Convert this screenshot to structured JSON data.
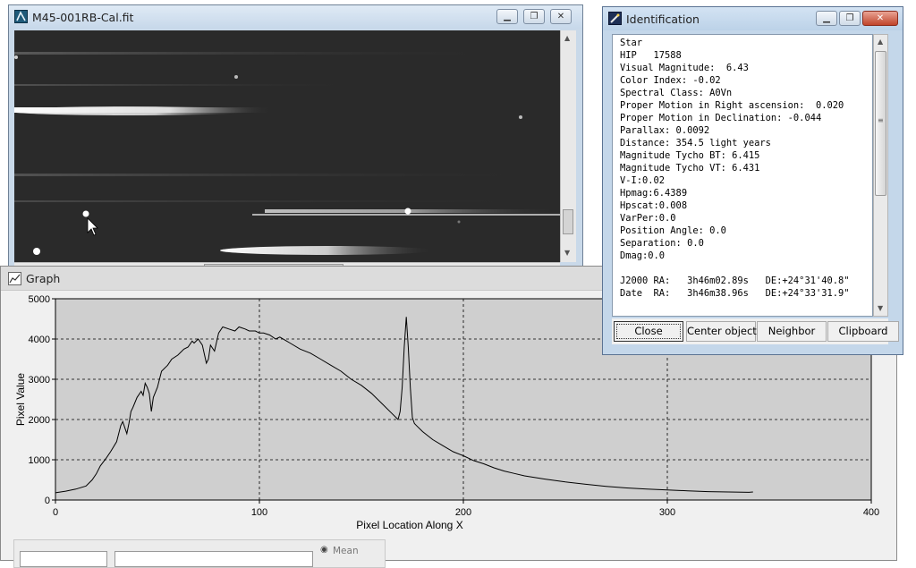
{
  "image_window": {
    "title": "M45-001RB-Cal.fit",
    "icon": "fits-image-icon"
  },
  "graph_window": {
    "title": "Graph",
    "icon": "graph-window-icon",
    "bottom_controls": {
      "mean_label": "Mean"
    }
  },
  "identification": {
    "title": "Identification",
    "icon": "telescope-icon",
    "lines": [
      "Star",
      "HIP   17588",
      "Visual Magnitude:  6.43",
      "Color Index: -0.02",
      "Spectral Class: A0Vn",
      "Proper Motion in Right ascension:  0.020",
      "Proper Motion in Declination: -0.044",
      "Parallax: 0.0092",
      "Distance: 354.5 light years",
      "Magnitude Tycho BT: 6.415",
      "Magnitude Tycho VT: 6.431",
      "V-I:0.02",
      "Hpmag:6.4389",
      "Hpscat:0.008",
      "VarPer:0.0",
      "Position Angle: 0.0",
      "Separation: 0.0",
      "Dmag:0.0",
      "",
      "J2000 RA:   3h46m02.89s   DE:+24°31'40.8\"",
      "Date  RA:   3h46m38.96s   DE:+24°33'31.9\""
    ],
    "buttons": {
      "close": "Close",
      "center": "Center object",
      "neighbor": "Neighbor",
      "clipboard": "Clipboard"
    }
  },
  "chart_data": {
    "type": "line",
    "xlabel": "Pixel Location Along X",
    "ylabel": "Pixel Value",
    "xlim": [
      0,
      400
    ],
    "ylim": [
      0,
      5000
    ],
    "xticks": [
      0,
      100,
      200,
      300,
      400
    ],
    "yticks": [
      0,
      1000,
      2000,
      3000,
      4000,
      5000
    ],
    "grid": true,
    "series": [
      {
        "x": [
          0,
          5,
          10,
          15,
          18,
          20,
          22,
          25,
          27,
          30,
          32,
          33,
          35,
          36,
          37,
          38,
          40,
          42,
          43,
          44,
          45,
          46,
          47,
          48,
          50,
          52,
          55,
          57,
          60,
          63,
          65,
          67,
          68,
          70,
          72,
          74,
          75,
          76,
          78,
          80,
          82,
          85,
          88,
          90,
          93,
          95,
          98,
          100,
          102,
          105,
          108,
          110,
          115,
          120,
          125,
          130,
          135,
          140,
          145,
          150,
          155,
          160,
          165,
          168,
          169,
          170,
          171,
          172,
          173,
          174,
          175,
          176,
          177,
          180,
          185,
          190,
          195,
          200,
          205,
          210,
          215,
          220,
          225,
          230,
          240,
          250,
          260,
          270,
          280,
          290,
          300,
          310,
          320,
          330,
          340,
          342
        ],
        "y": [
          180,
          220,
          270,
          350,
          500,
          650,
          850,
          1050,
          1200,
          1450,
          1850,
          1950,
          1650,
          1900,
          2200,
          2300,
          2550,
          2700,
          2600,
          2900,
          2800,
          2650,
          2200,
          2550,
          2800,
          3200,
          3350,
          3500,
          3600,
          3750,
          3800,
          3950,
          3900,
          4000,
          3850,
          3400,
          3500,
          3850,
          3700,
          4150,
          4300,
          4250,
          4200,
          4300,
          4250,
          4200,
          4200,
          4150,
          4150,
          4100,
          4000,
          4050,
          3900,
          3750,
          3650,
          3500,
          3350,
          3200,
          3000,
          2850,
          2650,
          2400,
          2150,
          2000,
          2200,
          2800,
          3800,
          4550,
          3800,
          2800,
          2050,
          1900,
          1850,
          1700,
          1500,
          1350,
          1200,
          1100,
          980,
          900,
          800,
          720,
          660,
          600,
          520,
          450,
          390,
          340,
          300,
          270,
          250,
          230,
          210,
          200,
          190,
          200
        ]
      }
    ]
  }
}
